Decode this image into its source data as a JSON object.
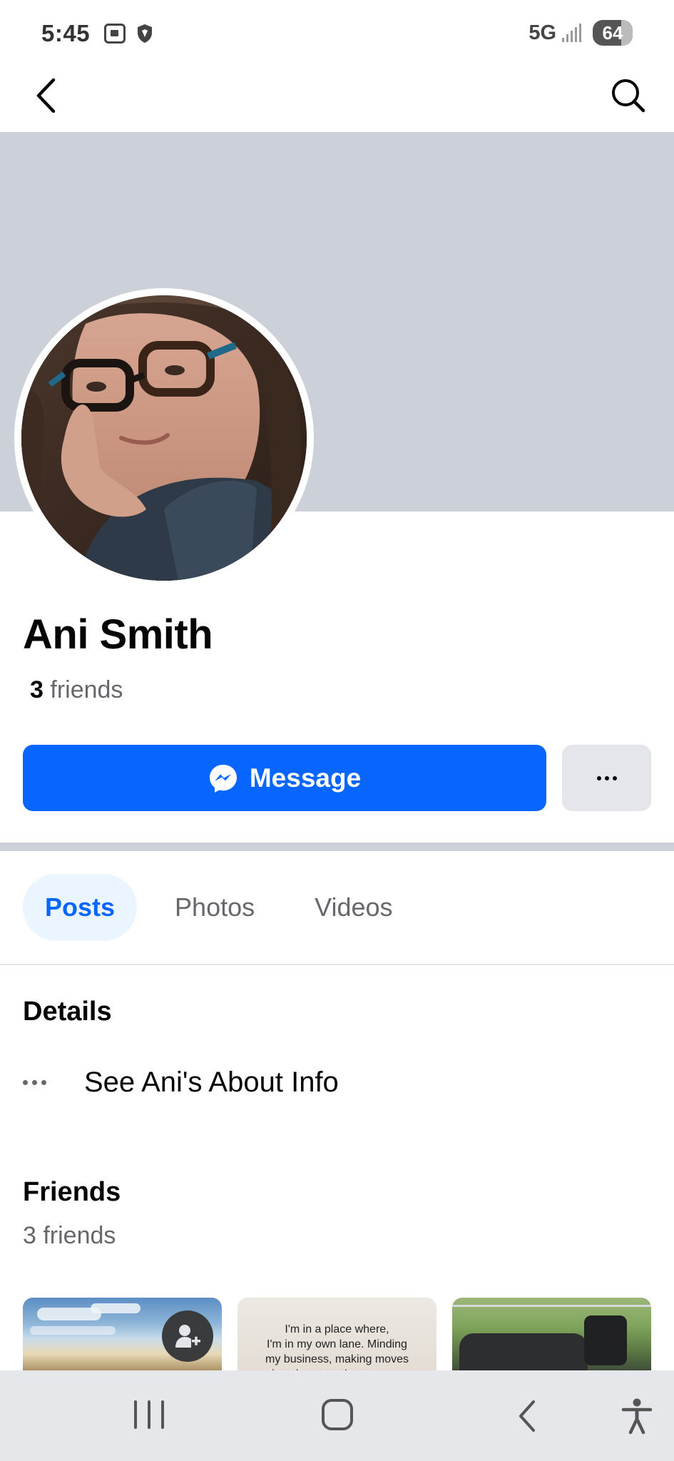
{
  "status_bar": {
    "time": "5:45",
    "network": "5G",
    "battery": "64"
  },
  "profile": {
    "name": "Ani Smith",
    "friends_count": "3",
    "friends_label": "friends"
  },
  "actions": {
    "message_label": "Message",
    "accent": "#0866ff"
  },
  "tabs": [
    {
      "label": "Posts",
      "active": true
    },
    {
      "label": "Photos",
      "active": false
    },
    {
      "label": "Videos",
      "active": false
    }
  ],
  "details": {
    "heading": "Details",
    "about_link": "See Ani's About Info"
  },
  "friends": {
    "heading": "Friends",
    "count_text": "3 friends",
    "quote_lines": [
      "I'm in a place where,",
      "I'm in my own lane. Minding",
      "my business, making moves",
      "privately, protecting my peace"
    ]
  },
  "icons": {
    "back": "chevron-left-icon",
    "search": "search-icon",
    "messenger": "messenger-icon",
    "more": "more-horizontal-icon",
    "add_friend": "add-friend-icon"
  }
}
